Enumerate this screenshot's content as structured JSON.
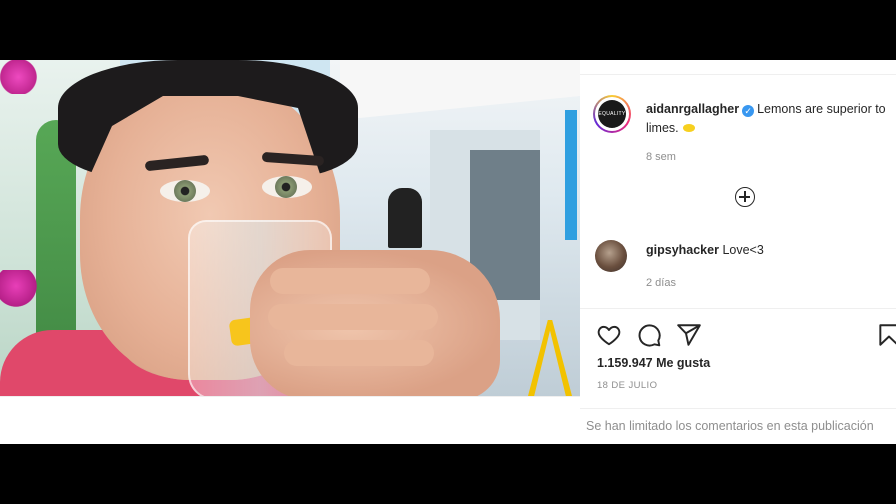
{
  "post": {
    "username": "aidanrgallagher",
    "caption_text": "Lemons are superior to limes.",
    "avatar_text": "EQUALITY",
    "posted_ago": "8 sem",
    "likes": "1.159.947 Me gusta",
    "date": "18 DE JULIO",
    "comments_limited": "Se han limitado los comentarios en esta publicación"
  },
  "comments": [
    {
      "username": "gipsyhacker",
      "text": "Love<3",
      "ago": "2 días"
    }
  ],
  "colors": {
    "verified": "#3897f0",
    "text": "#262626",
    "muted": "#8e8e8e"
  },
  "icons": [
    "verified-icon",
    "add-comment-icon",
    "heart-icon",
    "comment-icon",
    "share-icon",
    "bookmark-icon"
  ]
}
